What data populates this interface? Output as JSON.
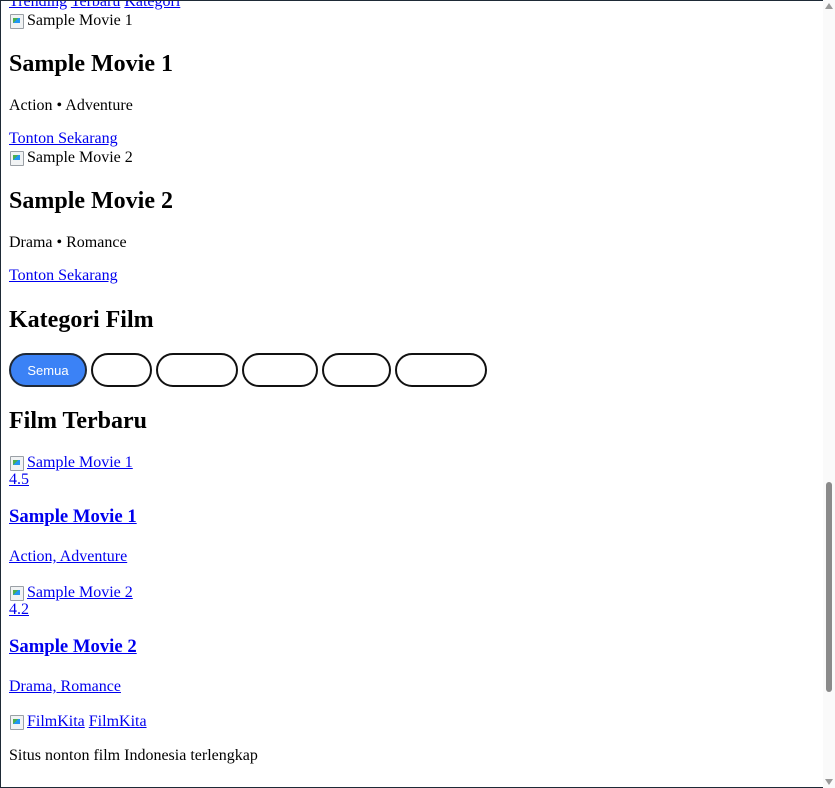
{
  "nav": {
    "links": [
      "Trending",
      "Terbaru",
      "Kategori"
    ]
  },
  "hero": [
    {
      "img_alt": "Sample Movie 1",
      "title": "Sample Movie 1",
      "genres": "Action • Adventure",
      "cta": "Tonton Sekarang"
    },
    {
      "img_alt": "Sample Movie 2",
      "title": "Sample Movie 2",
      "genres": "Drama • Romance",
      "cta": "Tonton Sekarang"
    }
  ],
  "categories": {
    "heading": "Kategori Film",
    "pills": [
      "Semua",
      "",
      "",
      "",
      "",
      ""
    ],
    "active_color": "#3b82f6"
  },
  "latest": {
    "heading": "Film Terbaru",
    "items": [
      {
        "img_alt": "Sample Movie 1",
        "rating": "4.5",
        "title": "Sample Movie 1",
        "genres": "Action, Adventure"
      },
      {
        "img_alt": "Sample Movie 2",
        "rating": "4.2",
        "title": "Sample Movie 2",
        "genres": "Drama, Romance"
      }
    ]
  },
  "footer": {
    "logo_alt": "FilmKita",
    "brand": "FilmKita",
    "tagline": "Situs nonton film Indonesia terlengkap"
  }
}
